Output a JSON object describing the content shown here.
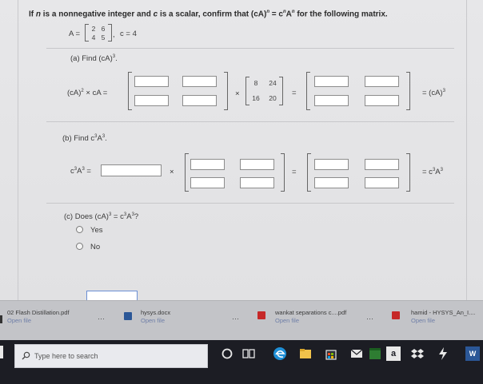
{
  "question": {
    "prompt_a": "If",
    "prompt_b": "n",
    "prompt_c": "is a nonnegative integer and",
    "prompt_d": "c",
    "prompt_e": "is a scalar, confirm that (cA)",
    "prompt_f": "n",
    "prompt_g": " = c",
    "prompt_h": "n",
    "prompt_i": "A",
    "prompt_j": "n",
    "prompt_k": "for the following matrix.",
    "matrix_label": "A =",
    "matrix": [
      "2",
      "6",
      "4",
      "5"
    ],
    "c_value": "c = 4"
  },
  "part_a": {
    "label": "(a) Find (cA)",
    "label_sup": "3",
    "label_end": ".",
    "lhs": "(cA)",
    "lhs_sup": "2",
    "lhs_rest": " × cA =",
    "times": "×",
    "given_matrix": [
      "8",
      "24",
      "16",
      "20"
    ],
    "equals": "=",
    "result": "= (cA)",
    "result_sup": "3"
  },
  "part_b": {
    "label": "(b) Find c",
    "label_sup1": "3",
    "label_mid": "A",
    "label_sup2": "3",
    "label_end": ".",
    "lhs": "c",
    "lhs_sup1": "3",
    "lhs_mid": "A",
    "lhs_sup2": "3",
    "lhs_end": " =",
    "times": "×",
    "equals": "=",
    "result": "= c",
    "result_sup1": "3",
    "result_mid": "A",
    "result_sup2": "3"
  },
  "part_c": {
    "label": "(c) Does  (cA)",
    "label_sup1": "3",
    "label_mid": " = c",
    "label_sup2": "3",
    "label_mid2": "A",
    "label_sup3": "3",
    "label_end": "?",
    "options": [
      "Yes",
      "No"
    ]
  },
  "downloads": [
    {
      "name": "02 Flash Distillation.pdf",
      "action": "Open file"
    },
    {
      "name": "hysys.docx",
      "action": "Open file"
    },
    {
      "name": "wankat separations c....pdf",
      "action": "Open file"
    },
    {
      "name": "hamid - HYSYS_An_I....",
      "action": "Open file"
    }
  ],
  "download_dots": "···",
  "taskbar": {
    "search_placeholder": "Type here to search",
    "letter_icon": "a",
    "word_icon": "W"
  }
}
